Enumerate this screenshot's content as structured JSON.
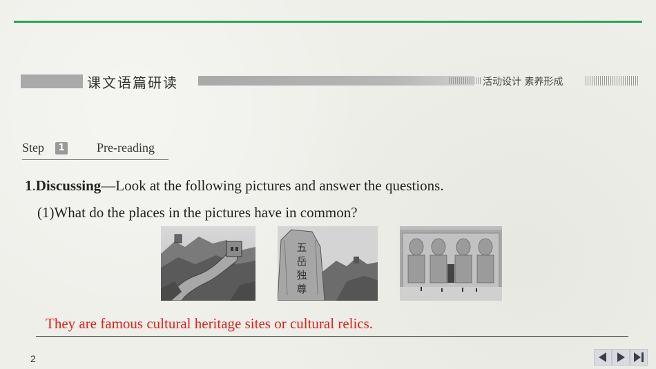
{
  "header": {
    "section_title": "课文语篇研读",
    "section_subtitle": "活动设计  素养形成"
  },
  "step": {
    "word": "Step",
    "number": "1",
    "label": "Pre-reading"
  },
  "question": {
    "number": "1",
    "sep": ".",
    "keyword": "Discussing",
    "text": "—Look at the following pictures and answer the questions.",
    "sub_question": "(1)What do the places in the pictures have in common?"
  },
  "pictures": [
    {
      "name": "great-wall-photo"
    },
    {
      "name": "mount-tai-inscription-photo"
    },
    {
      "name": "abu-simbel-temple-photo"
    }
  ],
  "answer": {
    "text": "They are famous cultural heritage sites or cultural relics.",
    "color": "#e0201b"
  },
  "footer": {
    "page_number": "2",
    "nav": [
      "prev-icon",
      "next-icon",
      "end-icon"
    ]
  },
  "colors": {
    "accent_line": "#2aa44f",
    "answer": "#e0201b"
  }
}
